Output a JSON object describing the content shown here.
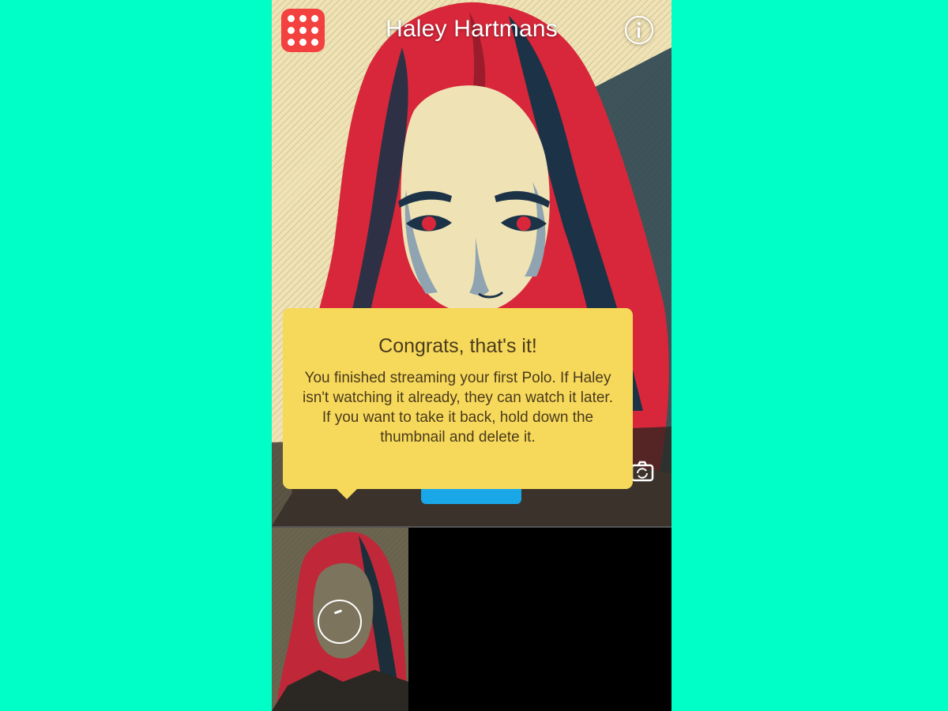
{
  "colors": {
    "background": "#00ffc6",
    "menu_button": "#f2413f",
    "tooltip": "#f6d95a",
    "tooltip_text": "#4a3a1e",
    "action_button": "#1aa7e8"
  },
  "header": {
    "title": "Haley Hartmans",
    "menu_icon": "grid-dots-icon",
    "info_icon": "info-icon"
  },
  "tooltip": {
    "heading": "Congrats, that's it!",
    "body": "You finished streaming your first Polo. If Haley isn't watching it already, they can watch it later. If you want to take it back, hold down the thumbnail and delete it."
  },
  "controls": {
    "camera_icon": "camera-flip-icon"
  },
  "thumbnails": {
    "items": [
      {
        "status_icon": "loading-spinner-icon"
      }
    ]
  }
}
